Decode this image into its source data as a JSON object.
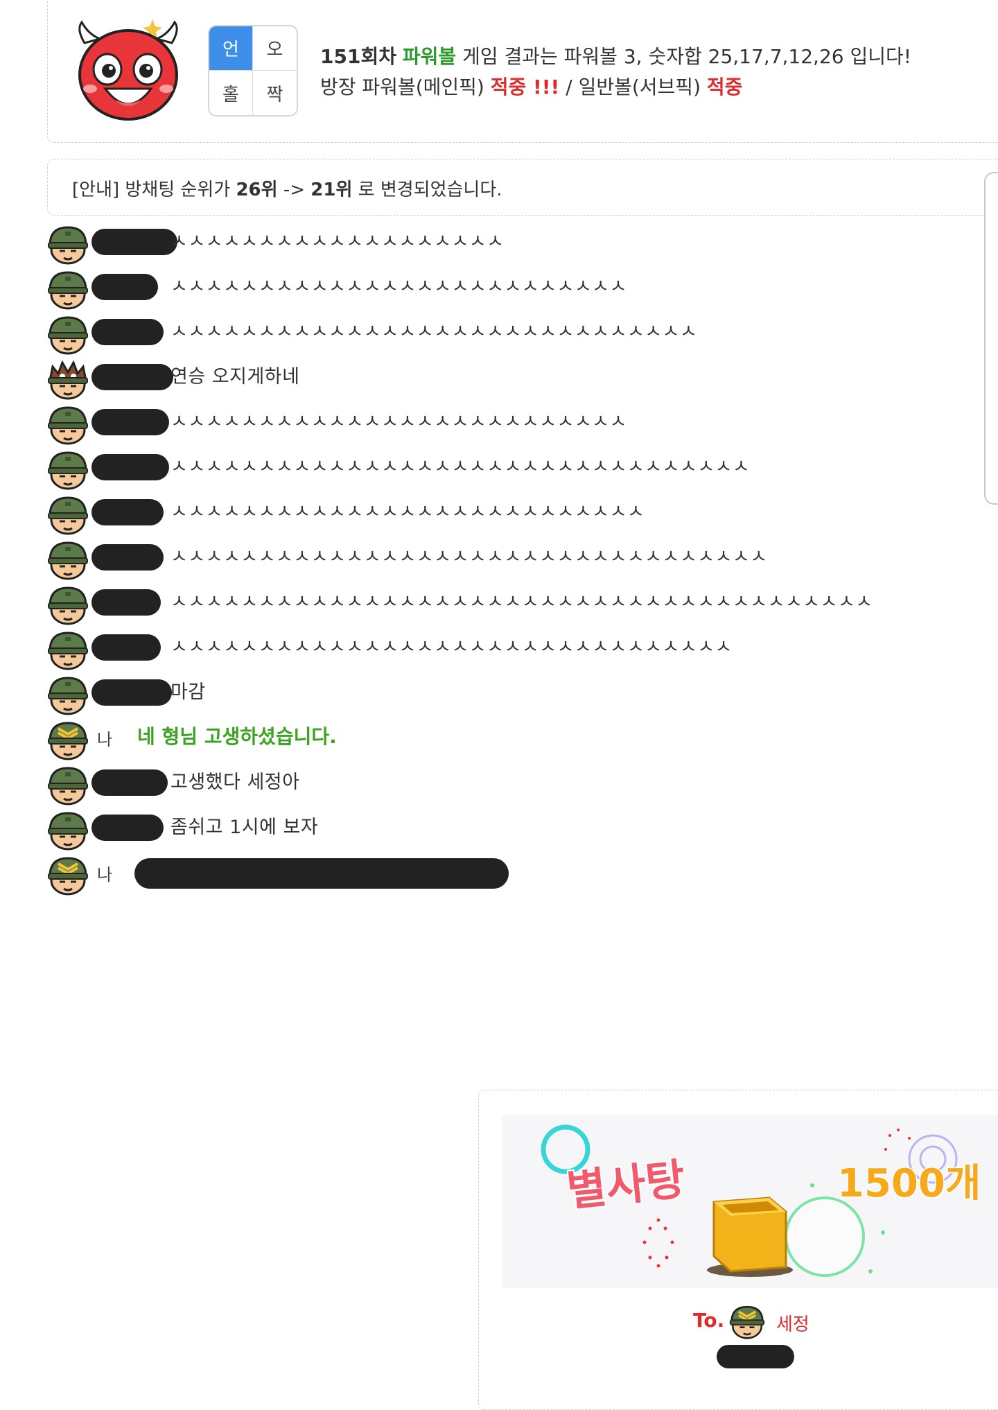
{
  "result": {
    "round": "151회차",
    "game": "파워볼",
    "text": "게임 결과는 파워볼 3, 숫자합 25,17,7,12,26 입니다!",
    "host_pick_label": "방장 파워볼(메인픽)",
    "host_pick_status": "적중 !!!",
    "separator": "/",
    "normal_pick_label": "일반볼(서브픽)",
    "normal_pick_status": "적중"
  },
  "pick_grid": {
    "cells": [
      "언",
      "오",
      "홀",
      "짝"
    ],
    "active": 0
  },
  "notice": {
    "prefix": "[안내] 방채팅 순위가",
    "from_rank": "26위",
    "arrow": "->",
    "to_rank": "21위",
    "suffix": "로 변경되었습니다."
  },
  "chat": [
    {
      "text": "ㅅㅅㅅㅅㅅㅅㅅㅅㅅㅅㅅㅅㅅㅅㅅㅅㅅㅅㅅ",
      "avatar": "soldier-icon"
    },
    {
      "text": "ㅅㅅㅅㅅㅅㅅㅅㅅㅅㅅㅅㅅㅅㅅㅅㅅㅅㅅㅅㅅㅅㅅㅅㅅㅅㅅ",
      "avatar": "soldier-icon"
    },
    {
      "text": "ㅅㅅㅅㅅㅅㅅㅅㅅㅅㅅㅅㅅㅅㅅㅅㅅㅅㅅㅅㅅㅅㅅㅅㅅㅅㅅㅅㅅㅅㅅ",
      "avatar": "soldier-icon"
    },
    {
      "text": "연승 오지게하네",
      "avatar": "spiky-helmet-icon"
    },
    {
      "text": "ㅅㅅㅅㅅㅅㅅㅅㅅㅅㅅㅅㅅㅅㅅㅅㅅㅅㅅㅅㅅㅅㅅㅅㅅㅅㅅ",
      "avatar": "soldier-icon"
    },
    {
      "text": "ㅅㅅㅅㅅㅅㅅㅅㅅㅅㅅㅅㅅㅅㅅㅅㅅㅅㅅㅅㅅㅅㅅㅅㅅㅅㅅㅅㅅㅅㅅㅅㅅㅅ",
      "avatar": "soldier-icon"
    },
    {
      "text": "ㅅㅅㅅㅅㅅㅅㅅㅅㅅㅅㅅㅅㅅㅅㅅㅅㅅㅅㅅㅅㅅㅅㅅㅅㅅㅅㅅ",
      "avatar": "soldier-icon"
    },
    {
      "text": "ㅅㅅㅅㅅㅅㅅㅅㅅㅅㅅㅅㅅㅅㅅㅅㅅㅅㅅㅅㅅㅅㅅㅅㅅㅅㅅㅅㅅㅅㅅㅅㅅㅅㅅ",
      "avatar": "soldier-icon"
    },
    {
      "text": "ㅅㅅㅅㅅㅅㅅㅅㅅㅅㅅㅅㅅㅅㅅㅅㅅㅅㅅㅅㅅㅅㅅㅅㅅㅅㅅㅅㅅㅅㅅㅅㅅㅅㅅㅅㅅㅅㅅㅅㅅ",
      "avatar": "soldier-icon"
    },
    {
      "text": "ㅅㅅㅅㅅㅅㅅㅅㅅㅅㅅㅅㅅㅅㅅㅅㅅㅅㅅㅅㅅㅅㅅㅅㅅㅅㅅㅅㅅㅅㅅㅅㅅ",
      "avatar": "soldier-icon"
    },
    {
      "text": "마감",
      "avatar": "soldier-icon"
    },
    {
      "text": "네 형님 고생하셨습니다.",
      "avatar": "sergeant-icon",
      "me": "나"
    },
    {
      "text": "고생했다 세정아",
      "avatar": "soldier-icon"
    },
    {
      "text": "좀쉬고 1시에 보자",
      "avatar": "soldier-icon"
    },
    {
      "text": "",
      "avatar": "sergeant-icon",
      "me": "나"
    }
  ],
  "gift": {
    "item": "별사탕",
    "count": "1500개",
    "to_label": "To.",
    "recipient": "세정"
  },
  "colors": {
    "green": "#2e9a2e",
    "red": "#e02a2a",
    "active_blue": "#3d8ee8",
    "chat_green": "#3aa31f"
  }
}
